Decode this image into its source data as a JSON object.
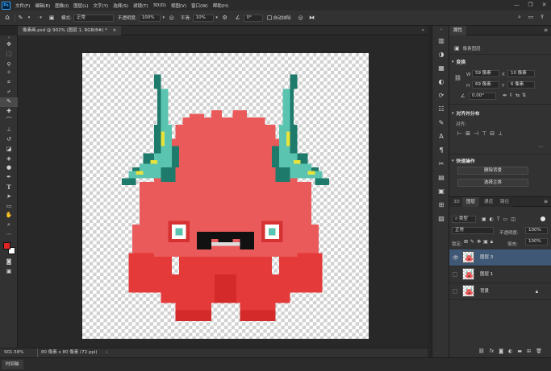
{
  "menubar": {
    "logo": "Ps",
    "items": [
      "文件(F)",
      "编辑(E)",
      "图像(I)",
      "图层(L)",
      "文字(Y)",
      "选择(S)",
      "滤镜(T)",
      "3D(D)",
      "视图(V)",
      "窗口(W)",
      "帮助(H)"
    ],
    "window_controls": [
      "—",
      "❐",
      "✕"
    ]
  },
  "options": {
    "mode_label": "模式:",
    "mode_value": "正常",
    "opacity_label": "不透明度:",
    "opacity_value": "100%",
    "smooth_label": "平滑:",
    "smooth_value": "10%",
    "angle_value": "0°",
    "auto_erase_label": "自动抹除"
  },
  "document": {
    "tab_title": "像素画.psd @ 902% (图层 1, RGB/8#) *",
    "close": "×"
  },
  "status": {
    "zoom": "901.58%",
    "size": "80 像素 x 80 像素 (72 ppi)",
    "arrow": "›"
  },
  "bottom": {
    "timeline_tab": "时间轴"
  },
  "properties": {
    "tab": "属性",
    "layer_kind": "像素图层",
    "transform_title": "变换",
    "w_label": "W",
    "w_value": "59 像素",
    "x_label": "X",
    "x_value": "10 像素",
    "h_label": "H",
    "h_value": "69 像素",
    "y_label": "Y",
    "y_value": "6 像素",
    "angle_value": "0.00°",
    "align_title": "对齐并分布",
    "align_sub": "对齐:",
    "quick_title": "快速操作",
    "btn_remove_bg": "删除背景",
    "btn_select_subject": "选择主体"
  },
  "layers_panel": {
    "tabs": [
      "3D",
      "图层",
      "通道",
      "路径"
    ],
    "filter_kind": "类型",
    "blend_mode": "正常",
    "opacity_label": "不透明度:",
    "opacity_value": "100%",
    "lock_label": "锁定:",
    "fill_label": "填充:",
    "fill_value": "100%",
    "layers": [
      {
        "name": "图层 3",
        "visible": true,
        "selected": true
      },
      {
        "name": "图层 1",
        "visible": false,
        "selected": false
      },
      {
        "name": "背景",
        "visible": false,
        "selected": false,
        "locked": true
      }
    ],
    "footer_icons": [
      "link-icon",
      "fx-icon",
      "mask-icon",
      "adjustment-icon",
      "group-icon",
      "new-layer-icon",
      "trash-icon"
    ]
  },
  "colors": {
    "monster_red": "#ea5a5a",
    "monster_dark": "#d63232",
    "horn_teal": "#5bc4b0",
    "horn_dark": "#1e7a6a",
    "horn_yellow": "#e8e23c",
    "selection": "#3f5876",
    "foreground": "#e02424",
    "background": "#ffffff"
  }
}
